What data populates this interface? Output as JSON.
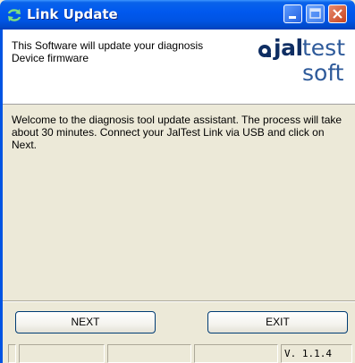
{
  "window": {
    "title": "Link Update",
    "title_icon": "refresh-arrows-icon",
    "controls": [
      "minimize-icon",
      "maximize-icon",
      "close-icon"
    ]
  },
  "header": {
    "description": "This Software will update your diagnosis Device firmware",
    "logo": {
      "brand": "jal",
      "brand_suffix": "test",
      "sub": "soft"
    }
  },
  "content": {
    "welcome": "Welcome to the diagnosis tool update assistant. The process will take about 30 minutes. Connect your JalTest Link via USB and click on Next."
  },
  "buttons": {
    "next": "NEXT",
    "exit": "EXIT"
  },
  "statusbar": {
    "version": "V. 1.1.4"
  },
  "colors": {
    "titlebar": "#0054e3",
    "dialog_bg": "#ece9d8",
    "logo_dark": "#0f2e63",
    "logo_light": "#2e5a9a",
    "close_button": "#c84420"
  }
}
